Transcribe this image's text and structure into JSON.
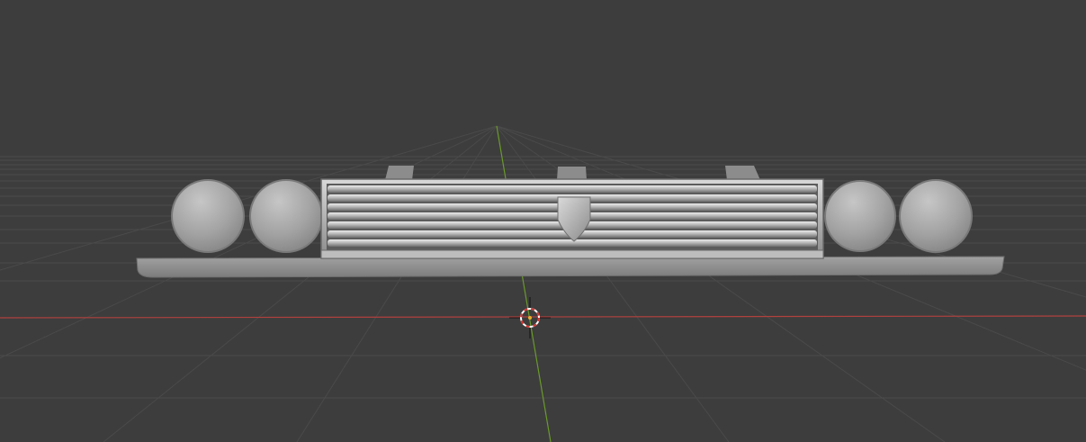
{
  "viewport": {
    "background": "#3d3d3d",
    "grid_color": "#4a4a4a",
    "x_axis_color": "#b0413e",
    "y_axis_color": "#6a9a2a",
    "model_color": "#9e9e9e",
    "objects": [
      {
        "name": "headlight",
        "count": 4
      },
      {
        "name": "grille",
        "slats": 7
      },
      {
        "name": "badge",
        "count": 1
      },
      {
        "name": "mount-bracket",
        "count": 3
      },
      {
        "name": "bumper",
        "count": 1
      }
    ],
    "cursor": {
      "icon": "3d-cursor-icon"
    }
  }
}
